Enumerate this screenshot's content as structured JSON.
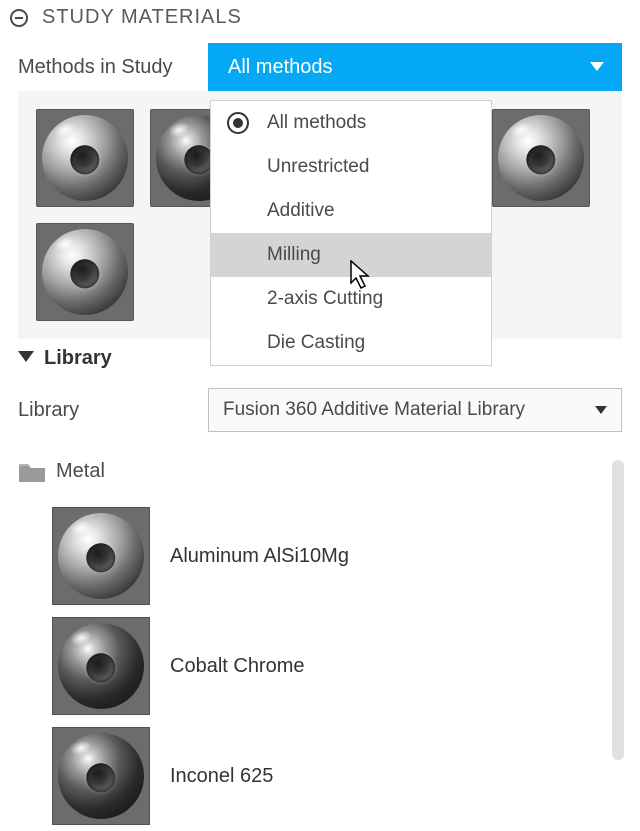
{
  "panel": {
    "title": "STUDY MATERIALS"
  },
  "methods": {
    "label": "Methods in Study",
    "selected": "All methods",
    "options": [
      {
        "label": "All methods",
        "checked": true,
        "highlight": false
      },
      {
        "label": "Unrestricted",
        "checked": false,
        "highlight": false
      },
      {
        "label": "Additive",
        "checked": false,
        "highlight": false
      },
      {
        "label": "Milling",
        "checked": false,
        "highlight": true
      },
      {
        "label": "2-axis Cutting",
        "checked": false,
        "highlight": false
      },
      {
        "label": "Die Casting",
        "checked": false,
        "highlight": false
      }
    ]
  },
  "library": {
    "section_title": "Library",
    "select_label": "Library",
    "selected": "Fusion 360 Additive Material Library",
    "category": "Metal",
    "materials": [
      {
        "name": "Aluminum AlSi10Mg",
        "variant": "light"
      },
      {
        "name": "Cobalt Chrome",
        "variant": "dark"
      },
      {
        "name": "Inconel 625",
        "variant": "dark"
      }
    ]
  }
}
